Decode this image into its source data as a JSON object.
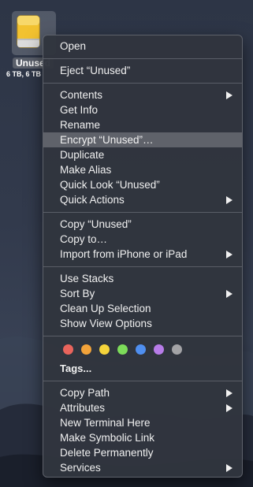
{
  "desktop": {
    "drive_name": "Unused",
    "drive_info": "6 TB, 6 TB"
  },
  "menu": {
    "groups": [
      [
        {
          "label": "Open",
          "submenu": false
        }
      ],
      [
        {
          "label": "Eject “Unused”",
          "submenu": false
        }
      ],
      [
        {
          "label": "Contents",
          "submenu": true
        },
        {
          "label": "Get Info",
          "submenu": false
        },
        {
          "label": "Rename",
          "submenu": false
        },
        {
          "label": "Encrypt “Unused”…",
          "submenu": false,
          "highlighted": true
        },
        {
          "label": "Duplicate",
          "submenu": false
        },
        {
          "label": "Make Alias",
          "submenu": false
        },
        {
          "label": "Quick Look “Unused”",
          "submenu": false
        },
        {
          "label": "Quick Actions",
          "submenu": true
        }
      ],
      [
        {
          "label": "Copy “Unused”",
          "submenu": false
        },
        {
          "label": "Copy to…",
          "submenu": false
        },
        {
          "label": "Import from iPhone or iPad",
          "submenu": true
        }
      ],
      [
        {
          "label": "Use Stacks",
          "submenu": false
        },
        {
          "label": "Sort By",
          "submenu": true
        },
        {
          "label": "Clean Up Selection",
          "submenu": false
        },
        {
          "label": "Show View Options",
          "submenu": false
        }
      ],
      [
        {
          "label": "Copy Path",
          "submenu": true
        },
        {
          "label": "Attributes",
          "submenu": true
        },
        {
          "label": "New Terminal Here",
          "submenu": false
        },
        {
          "label": "Make Symbolic Link",
          "submenu": false
        },
        {
          "label": "Delete Permanently",
          "submenu": false
        },
        {
          "label": "Services",
          "submenu": true
        }
      ]
    ],
    "tags_label": "Tags...",
    "tag_colors": [
      {
        "name": "red",
        "color": "#e9645c"
      },
      {
        "name": "orange",
        "color": "#f2a33a"
      },
      {
        "name": "yellow",
        "color": "#f5d43b"
      },
      {
        "name": "green",
        "color": "#7ddc5a"
      },
      {
        "name": "blue",
        "color": "#4f8ff0"
      },
      {
        "name": "purple",
        "color": "#b77ce8"
      },
      {
        "name": "gray",
        "color": "#a3a3a6"
      }
    ],
    "highlight_color": "#5f626a"
  }
}
